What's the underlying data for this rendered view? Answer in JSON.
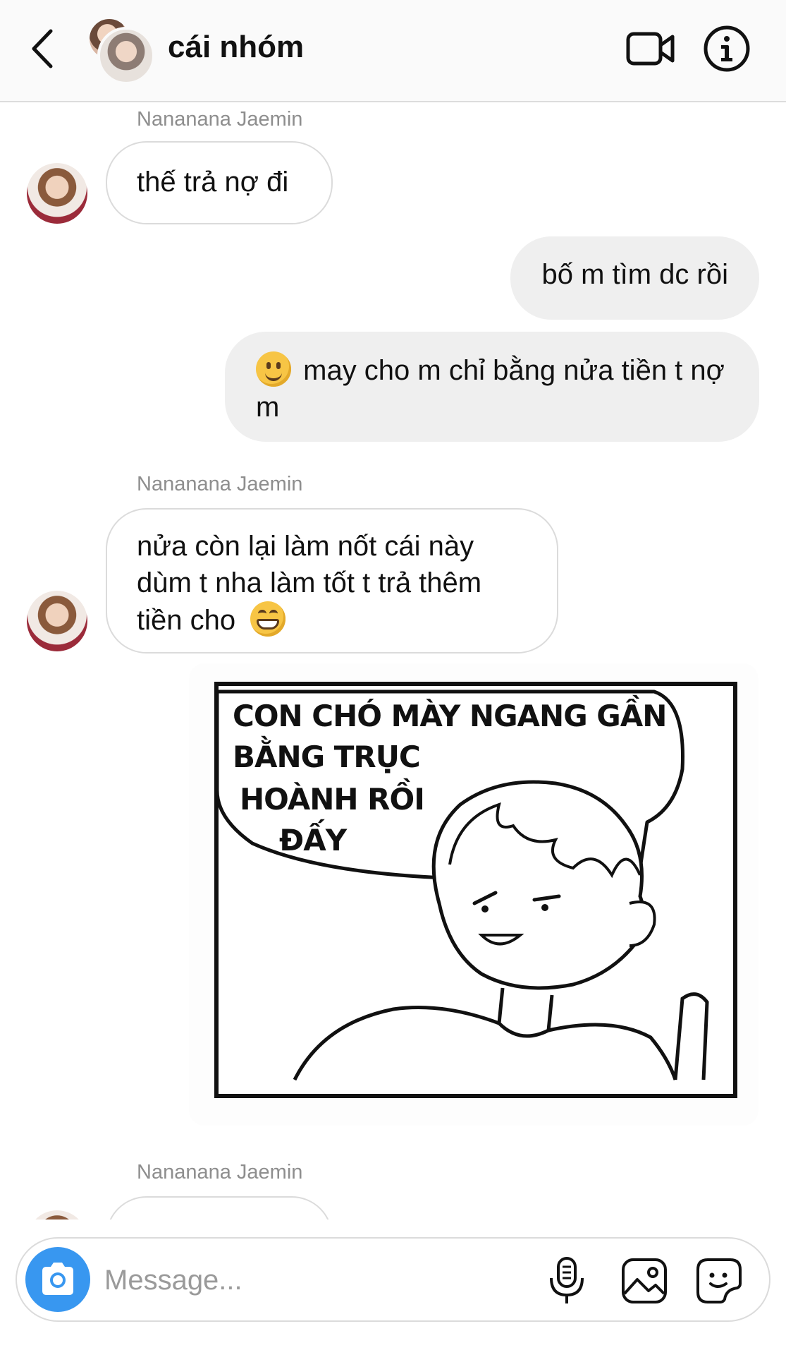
{
  "header": {
    "title": "cái nhóm",
    "icons": [
      "back-arrow-icon",
      "video-camera-icon",
      "info-icon"
    ]
  },
  "messages": [
    {
      "type": "incoming",
      "sender": "Nananana Jaemin",
      "text": "thế trả nợ đi"
    },
    {
      "type": "outgoing",
      "text": "bố m tìm dc rồi"
    },
    {
      "type": "outgoing",
      "emoji": "slightly-smiling-face",
      "text": "may cho m chỉ bằng nửa tiền t nợ m"
    },
    {
      "type": "incoming",
      "sender": "Nananana Jaemin",
      "lines": [
        "nửa còn lại làm nốt cái này",
        "dùm t nha làm tốt t trả thêm",
        "tiền cho"
      ],
      "emoji": "grinning-face"
    },
    {
      "type": "outgoing-image",
      "caption_lines": [
        "CON CHÓ MÀY NGANG GẦN",
        "BẰNG TRỤC",
        "HOÀNH RỒI",
        "ĐẤY"
      ]
    },
    {
      "type": "incoming",
      "sender": "Nananana Jaemin"
    }
  ],
  "composer": {
    "placeholder": "Message...",
    "icons": [
      "camera-icon",
      "microphone-icon",
      "gallery-icon",
      "sticker-icon"
    ],
    "camera_color": "#3897f0"
  },
  "colors": {
    "outgoing_bubble": "#efefef",
    "incoming_border": "#dbdbdb",
    "header_bg": "#fafafa"
  }
}
